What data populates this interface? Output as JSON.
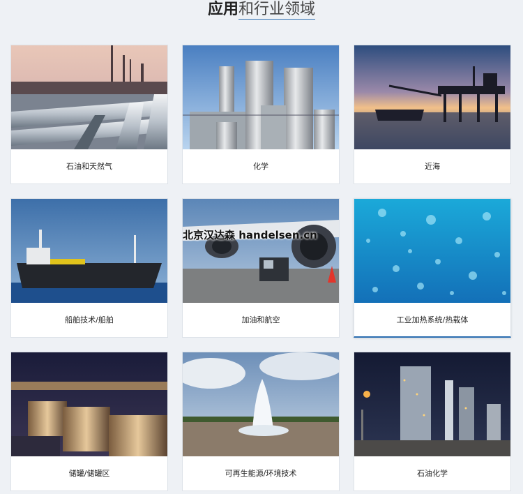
{
  "section": {
    "title_bold": "应用",
    "title_rest": "和行业领域"
  },
  "cards": [
    {
      "label": "石油和天然气",
      "icon": "pipeline-image"
    },
    {
      "label": "化学",
      "icon": "chemical-plant-image"
    },
    {
      "label": "近海",
      "icon": "offshore-platform-image"
    },
    {
      "label": "船舶技术/船舶",
      "icon": "ship-image"
    },
    {
      "label": "加油和航空",
      "icon": "aircraft-fueling-image"
    },
    {
      "label": "工业加热系统/热载体",
      "icon": "bubbles-image"
    },
    {
      "label": "储罐/储罐区",
      "icon": "tank-farm-image"
    },
    {
      "label": "可再生能源/环境技术",
      "icon": "geyser-image"
    },
    {
      "label": "石油化学",
      "icon": "refinery-night-image"
    }
  ],
  "watermark": "北京汉达森 handelsen.cn",
  "colors": {
    "accent": "#2a6db0",
    "background": "#eef1f5"
  }
}
